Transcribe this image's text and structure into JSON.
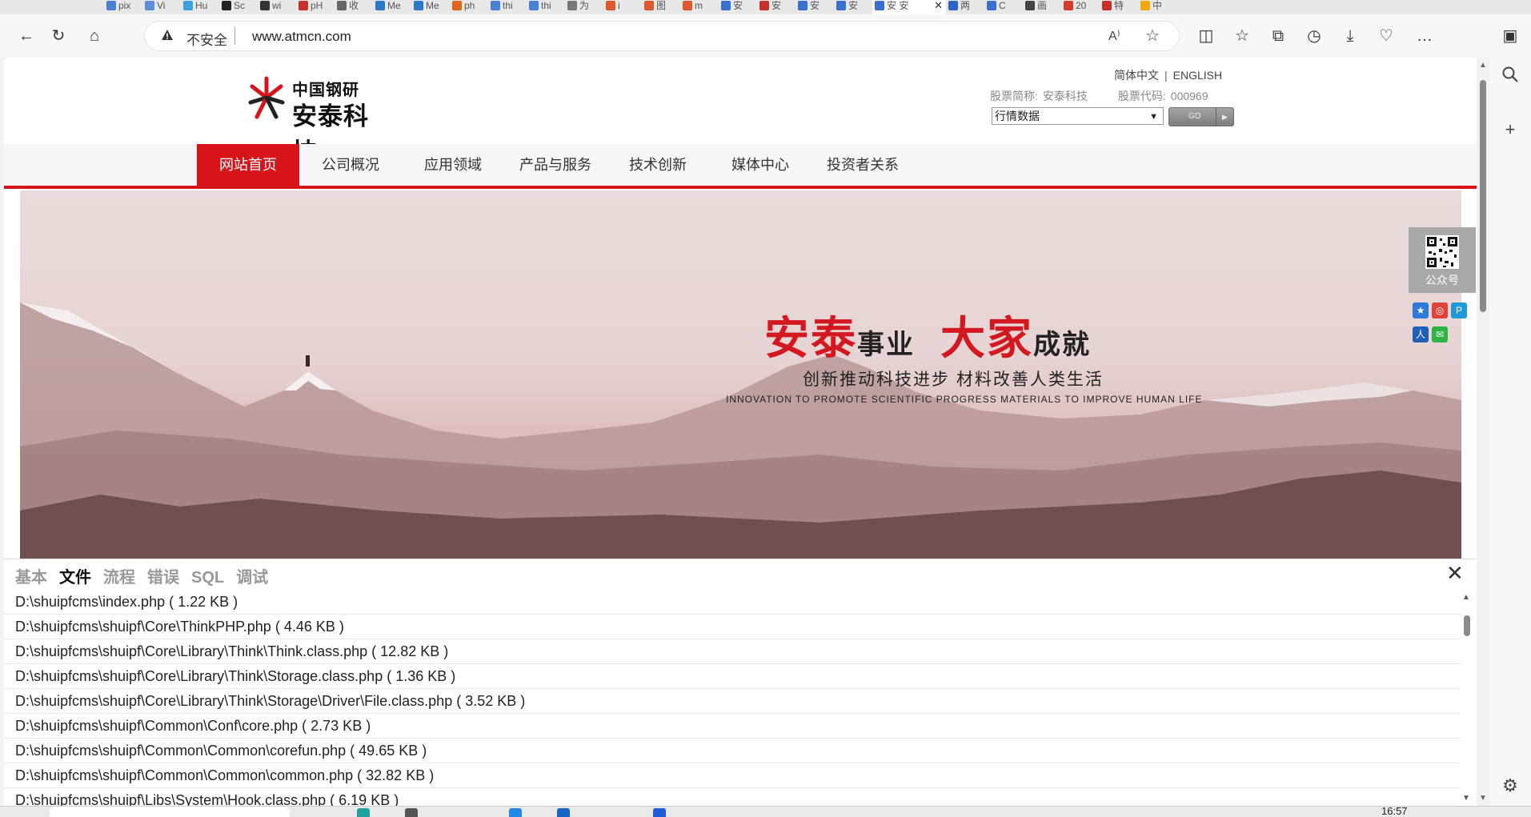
{
  "browser": {
    "tabs": [
      {
        "label": "pix",
        "color": "#4a7fd6"
      },
      {
        "label": "Vi",
        "color": "#5b8fd9"
      },
      {
        "label": "Hu",
        "color": "#3aa0e0"
      },
      {
        "label": "Sc",
        "color": "#222222"
      },
      {
        "label": "wi",
        "color": "#333333"
      },
      {
        "label": "pH",
        "color": "#c8312a"
      },
      {
        "label": "收",
        "color": "#666666"
      },
      {
        "label": "Me",
        "color": "#2b79c9"
      },
      {
        "label": "Me",
        "color": "#2b79c9"
      },
      {
        "label": "ph",
        "color": "#e0671a"
      },
      {
        "label": "thi",
        "color": "#4a7fd6"
      },
      {
        "label": "thi",
        "color": "#4a7fd6"
      },
      {
        "label": "为",
        "color": "#777777"
      },
      {
        "label": "i",
        "color": "#e0562e"
      },
      {
        "label": "图",
        "color": "#e0562e"
      },
      {
        "label": "m",
        "color": "#e0562e"
      },
      {
        "label": "安",
        "color": "#3a6fd1"
      },
      {
        "label": "安",
        "color": "#c8312a"
      },
      {
        "label": "安",
        "color": "#3a6fd1"
      },
      {
        "label": "安",
        "color": "#3a6fd1"
      },
      {
        "label": "安 安",
        "color": "#3a6fd1",
        "active": true
      },
      {
        "label": "两",
        "color": "#2d63c8"
      },
      {
        "label": "C",
        "color": "#3a6fd1"
      },
      {
        "label": "画",
        "color": "#444444"
      },
      {
        "label": "20",
        "color": "#d93b2b"
      },
      {
        "label": "特",
        "color": "#c8312a"
      },
      {
        "label": "中",
        "color": "#f2a900"
      }
    ],
    "active_tab_close": "✕",
    "address": {
      "warning_icon": "warning-icon",
      "insecure_label": "不安全",
      "url": "www.atmcn.com",
      "read_aloud": "A⁾",
      "favorite": "☆"
    },
    "toolbar_icons": {
      "back": "←",
      "refresh": "↻",
      "home": "⌂",
      "split": "◫",
      "favorites": "☆",
      "collections": "⧉",
      "history": "◷",
      "downloads": "⤓",
      "vpn": "♡",
      "more": "…",
      "sidebar": "▣"
    }
  },
  "site": {
    "logo": {
      "top": "中国钢研",
      "bottom": "安泰科技"
    },
    "lang": {
      "cn": "简体中文",
      "separator": "|",
      "en": "ENGLISH"
    },
    "stock": {
      "name_label": "股票简称:",
      "name": "安泰科技",
      "code_label": "股票代码:",
      "code": "000969"
    },
    "market_select": {
      "value": "行情数据"
    },
    "go_label": "GO",
    "nav": [
      "网站首页",
      "公司概况",
      "应用领域",
      "产品与服务",
      "技术创新",
      "媒体中心",
      "投资者关系"
    ],
    "nav_active": 0,
    "banner": {
      "red1": "安泰",
      "blk1": "事业",
      "red2": "大家",
      "blk2": "成就",
      "sub_cn": "创新推动科技进步  材料改善人类生活",
      "sub_en": "INNOVATION TO PROMOTE SCIENTIFIC PROGRESS MATERIALS TO IMPROVE HUMAN LIFE"
    },
    "qr_label": "公众号",
    "share_icons": [
      {
        "name": "qzone-icon",
        "color": "#2d7bd6",
        "glyph": "★"
      },
      {
        "name": "weibo-icon",
        "color": "#e0433a",
        "glyph": "◎"
      },
      {
        "name": "tencent-icon",
        "color": "#1e9ad8",
        "glyph": "P"
      },
      {
        "name": "renren-icon",
        "color": "#1f5fb8",
        "glyph": "人"
      },
      {
        "name": "wechat-icon",
        "color": "#2db446",
        "glyph": "✉"
      }
    ]
  },
  "debug": {
    "tabs": [
      "基本",
      "文件",
      "流程",
      "错误",
      "SQL",
      "调试"
    ],
    "active_tab": 1,
    "close": "✕",
    "files": [
      "D:\\shuipfcms\\index.php ( 1.22 KB )",
      "D:\\shuipfcms\\shuipf\\Core\\ThinkPHP.php ( 4.46 KB )",
      "D:\\shuipfcms\\shuipf\\Core\\Library\\Think\\Think.class.php ( 12.82 KB )",
      "D:\\shuipfcms\\shuipf\\Core\\Library\\Think\\Storage.class.php ( 1.36 KB )",
      "D:\\shuipfcms\\shuipf\\Core\\Library\\Think\\Storage\\Driver\\File.class.php ( 3.52 KB )",
      "D:\\shuipfcms\\shuipf\\Common\\Conf\\core.php ( 2.73 KB )",
      "D:\\shuipfcms\\shuipf\\Common\\Common\\corefun.php ( 49.65 KB )",
      "D:\\shuipfcms\\shuipf\\Common\\Common\\common.php ( 32.82 KB )",
      "D:\\shuipfcms\\shuipf\\Libs\\System\\Hook.class.php ( 6.19 KB )"
    ]
  },
  "taskbar": {
    "clock": "16:57"
  }
}
